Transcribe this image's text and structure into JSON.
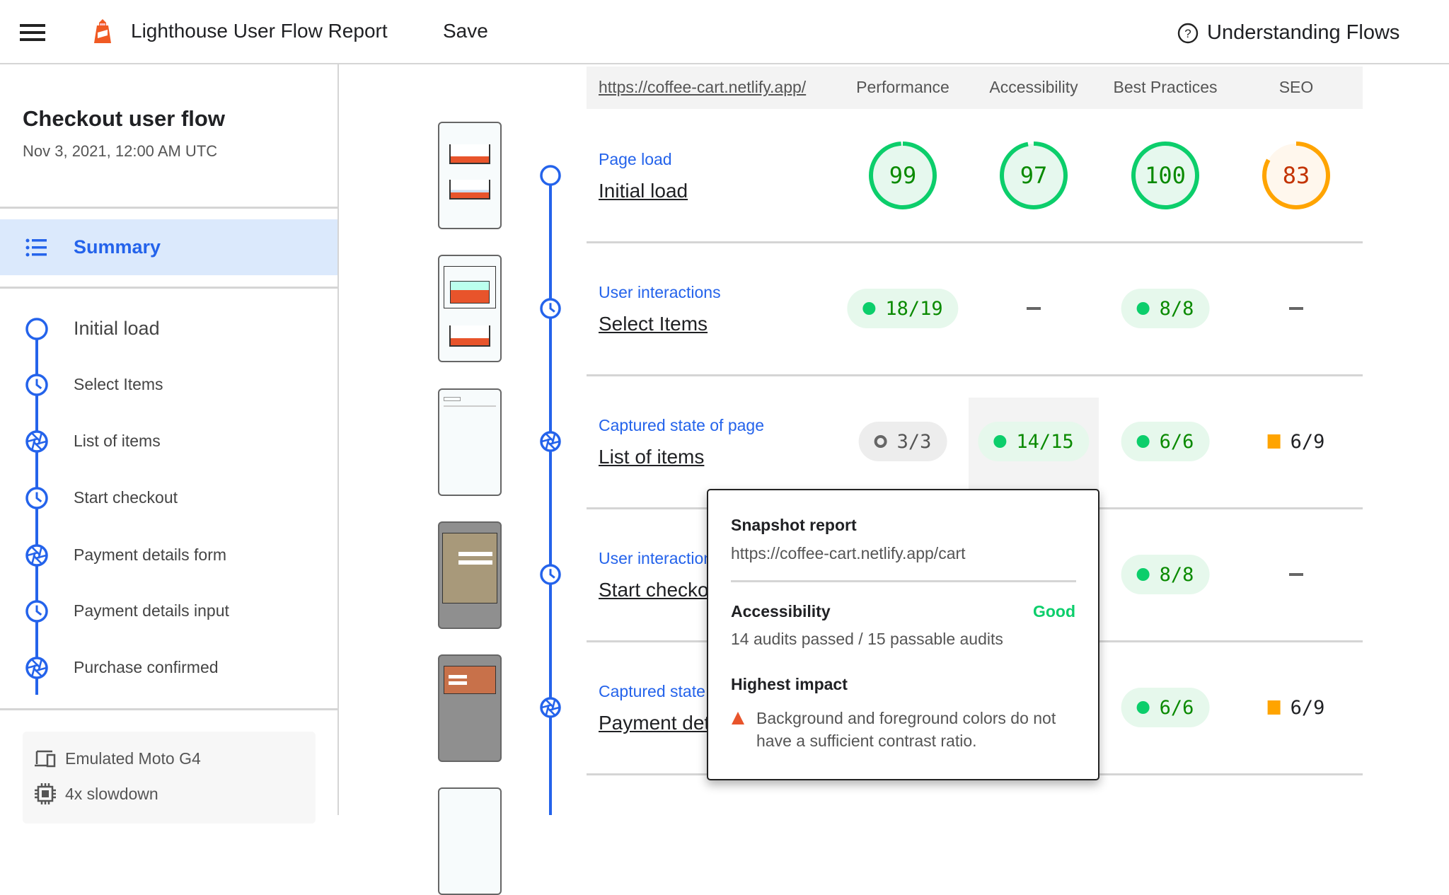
{
  "header": {
    "title": "Lighthouse User Flow Report",
    "save_label": "Save",
    "help_label": "Understanding Flows",
    "menu_icon": "hamburger-icon",
    "logo_icon": "lighthouse-logo",
    "help_icon": "help-circle-icon"
  },
  "sidebar": {
    "flow_title": "Checkout user flow",
    "flow_date": "Nov 3, 2021, 12:00 AM UTC",
    "summary_label": "Summary",
    "steps": [
      {
        "label": "Initial load",
        "icon": "navigation"
      },
      {
        "label": "Select Items",
        "icon": "timespan"
      },
      {
        "label": "List of items",
        "icon": "snapshot"
      },
      {
        "label": "Start checkout",
        "icon": "timespan"
      },
      {
        "label": "Payment details form",
        "icon": "snapshot"
      },
      {
        "label": "Payment details input",
        "icon": "timespan"
      },
      {
        "label": "Purchase confirmed",
        "icon": "snapshot"
      }
    ],
    "env": [
      {
        "label": "Emulated Moto G4",
        "icon": "devices-icon"
      },
      {
        "label": "4x slowdown",
        "icon": "cpu-icon"
      }
    ]
  },
  "colors": {
    "accent": "#2463eb",
    "pass": "#0cce6b",
    "pass_text": "#0a8a00",
    "average": "#ffa400",
    "average_text": "#c33300"
  },
  "table": {
    "url": "https://coffee-cart.netlify.app/",
    "columns": [
      "Performance",
      "Accessibility",
      "Best Practices",
      "SEO"
    ],
    "rows": [
      {
        "type": "Page load",
        "name": "Initial load",
        "icon": "navigation",
        "scores": [
          {
            "kind": "gauge",
            "value": "99",
            "rating": "pass"
          },
          {
            "kind": "gauge",
            "value": "97",
            "rating": "pass"
          },
          {
            "kind": "gauge",
            "value": "100",
            "rating": "pass"
          },
          {
            "kind": "gauge",
            "value": "83",
            "rating": "average"
          }
        ]
      },
      {
        "type": "User interactions",
        "name": "Select Items",
        "icon": "timespan",
        "scores": [
          {
            "kind": "pill",
            "value": "18/19",
            "rating": "pass"
          },
          {
            "kind": "none"
          },
          {
            "kind": "pill",
            "value": "8/8",
            "rating": "pass"
          },
          {
            "kind": "none"
          }
        ]
      },
      {
        "type": "Captured state of page",
        "name": "List of items",
        "icon": "snapshot",
        "scores": [
          {
            "kind": "pill",
            "value": "3/3",
            "rating": "na"
          },
          {
            "kind": "pill",
            "value": "14/15",
            "rating": "pass"
          },
          {
            "kind": "pill",
            "value": "6/6",
            "rating": "pass"
          },
          {
            "kind": "pill",
            "value": "6/9",
            "rating": "average"
          }
        ]
      },
      {
        "type": "User interactions",
        "name": "Start checkout",
        "icon": "timespan",
        "scores": [
          {
            "kind": "hidden"
          },
          {
            "kind": "hidden"
          },
          {
            "kind": "pill",
            "value": "8/8",
            "rating": "pass"
          },
          {
            "kind": "none"
          }
        ]
      },
      {
        "type": "Captured state of page",
        "name": "Payment details form",
        "icon": "snapshot",
        "scores": [
          {
            "kind": "hidden"
          },
          {
            "kind": "hidden"
          },
          {
            "kind": "pill",
            "value": "6/6",
            "rating": "pass"
          },
          {
            "kind": "pill",
            "value": "6/9",
            "rating": "average"
          }
        ]
      }
    ]
  },
  "tooltip": {
    "title": "Snapshot report",
    "url": "https://coffee-cart.netlify.app/cart",
    "category": "Accessibility",
    "rating": "Good",
    "audits": "14 audits passed / 15 passable audits",
    "impact_title": "Highest impact",
    "impact_text": "Background and foreground colors do not have a sufficient contrast ratio."
  }
}
